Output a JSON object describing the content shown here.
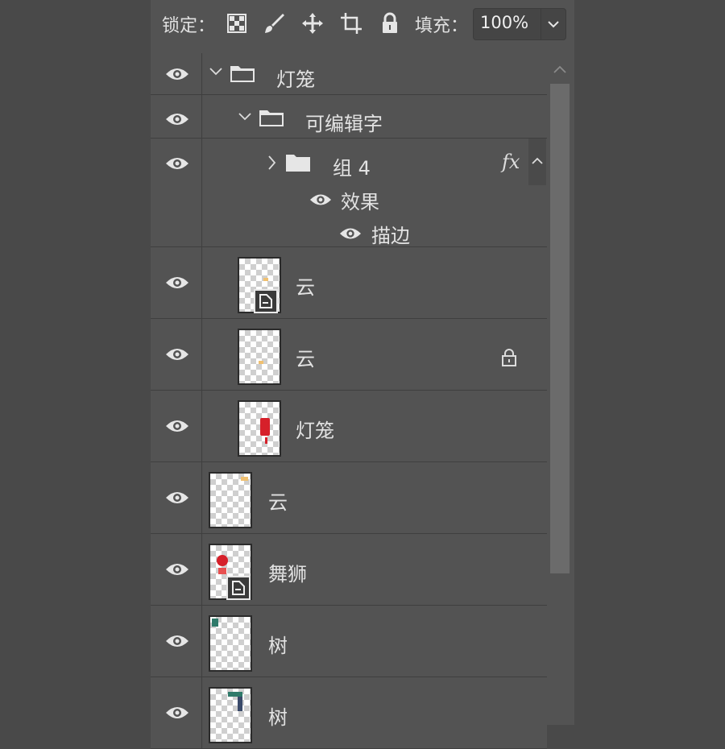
{
  "toolbar": {
    "lock_label": "锁定：",
    "fill_label": "填充：",
    "fill_value": "100%",
    "icons": [
      "transparency-lock-icon",
      "brush-icon",
      "move-icon",
      "artboard-icon",
      "lock-icon",
      "chevron-down-icon"
    ]
  },
  "layers": [
    {
      "name": "灯笼",
      "type": "group",
      "expanded": true
    },
    {
      "name": "可编辑字",
      "type": "group",
      "expanded": true
    },
    {
      "name": "组 4",
      "type": "group",
      "expanded": false,
      "fx": "fx",
      "effects_label": "效果",
      "effect_items": [
        "描边"
      ]
    },
    {
      "name": "云",
      "type": "smart-object"
    },
    {
      "name": "云",
      "type": "layer",
      "locked": true
    },
    {
      "name": "灯笼",
      "type": "layer"
    },
    {
      "name": "云",
      "type": "layer"
    },
    {
      "name": "舞狮",
      "type": "smart-object"
    },
    {
      "name": "树",
      "type": "layer"
    },
    {
      "name": "树",
      "type": "layer"
    }
  ],
  "colors": {
    "panel": "#535353",
    "background": "#494949",
    "text": "#e2e2e2",
    "lantern_red": "#d6202a"
  }
}
